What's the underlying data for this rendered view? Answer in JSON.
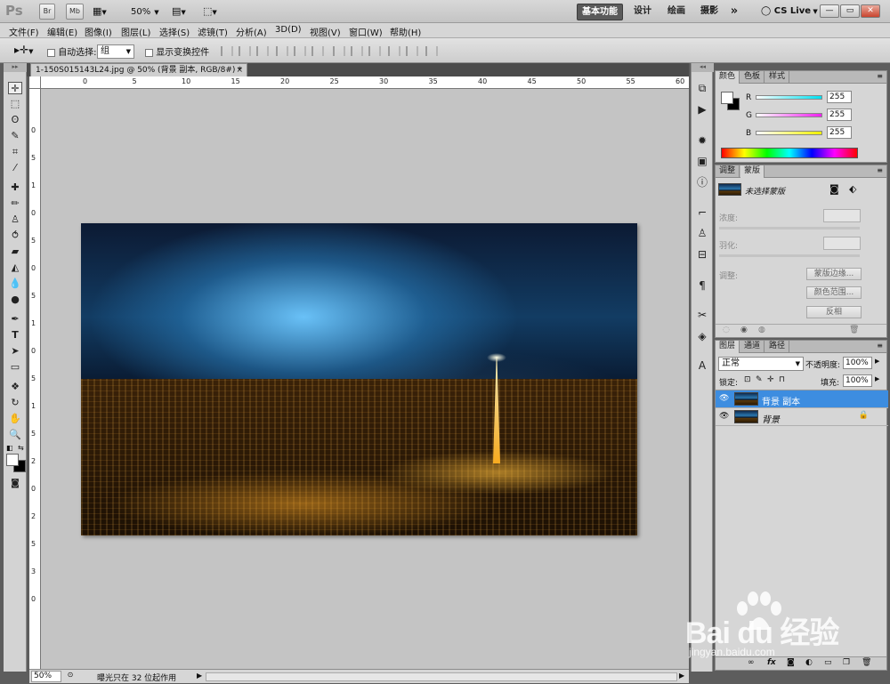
{
  "app": {
    "logo": "Ps",
    "toolbar_buttons": [
      "Br",
      "Mb"
    ],
    "zoom_level": "50%",
    "workspaces": [
      "基本功能",
      "设计",
      "绘画",
      "摄影"
    ],
    "more": "»",
    "cslive": "CS Live",
    "window_buttons": [
      "—",
      "▭",
      "✕"
    ]
  },
  "menu": [
    "文件(F)",
    "编辑(E)",
    "图像(I)",
    "图层(L)",
    "选择(S)",
    "滤镜(T)",
    "分析(A)",
    "3D(D)",
    "视图(V)",
    "窗口(W)",
    "帮助(H)"
  ],
  "options": {
    "auto_select_label": "自动选择:",
    "auto_select_value": "组",
    "show_transform_label": "显示变换控件"
  },
  "document": {
    "tab_title": "1-150S015143L24.jpg @ 50% (背景 副本, RGB/8#) *",
    "close": "×"
  },
  "rulers": {
    "h_ticks": [
      "0",
      "5",
      "10",
      "15",
      "20",
      "25",
      "30",
      "35",
      "40",
      "45",
      "50",
      "55",
      "60"
    ],
    "v_ticks": [
      "0",
      "5",
      "1",
      "0",
      "5",
      "0",
      "5",
      "1",
      "0",
      "5",
      "1",
      "5",
      "2",
      "0",
      "2",
      "5",
      "3",
      "0"
    ]
  },
  "status": {
    "zoom": "50%",
    "info": "曝光只在 32 位起作用"
  },
  "color_panel": {
    "tabs": [
      "颜色",
      "色板",
      "样式"
    ],
    "channels": [
      {
        "label": "R",
        "value": "255",
        "color": "#00e0f0"
      },
      {
        "label": "G",
        "value": "255",
        "color": "#f020f0"
      },
      {
        "label": "B",
        "value": "255",
        "color": "#f0f000"
      }
    ]
  },
  "masks_panel": {
    "tabs": [
      "调整",
      "蒙版"
    ],
    "no_mask": "未选择蒙版",
    "density_label": "浓度:",
    "feather_label": "羽化:",
    "refine_label": "调整:",
    "buttons": [
      "蒙版边缘...",
      "颜色范围...",
      "反相"
    ]
  },
  "layers_panel": {
    "tabs": [
      "图层",
      "通道",
      "路径"
    ],
    "blend_mode": "正常",
    "opacity_label": "不透明度:",
    "opacity_value": "100%",
    "lock_label": "锁定:",
    "fill_label": "填充:",
    "fill_value": "100%",
    "layers": [
      {
        "name": "背景 副本",
        "selected": true,
        "locked": false
      },
      {
        "name": "背景",
        "selected": false,
        "locked": true
      }
    ],
    "footer_icons": [
      "link-icon",
      "fx-icon",
      "mask-icon",
      "adjustment-icon",
      "group-icon",
      "new-layer-icon",
      "trash-icon"
    ]
  },
  "watermark": {
    "logo": "Bai du 经验",
    "url": "jingyan.baidu.com"
  }
}
